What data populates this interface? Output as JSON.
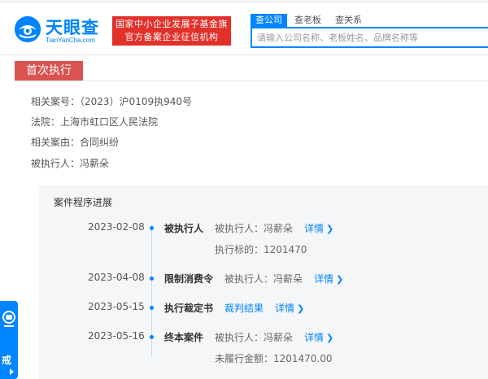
{
  "header": {
    "logo_name": "天眼查",
    "logo_domain": "TianYanCha.com",
    "slogan_line1": "国家中小企业发展子基金旗下",
    "slogan_line2": "官方备案企业征信机构",
    "tabs": [
      {
        "label": "查公司"
      },
      {
        "label": "查老板"
      },
      {
        "label": "查关系"
      }
    ],
    "search_placeholder": "请输入公司名称、老板姓名、品牌名称等"
  },
  "section": {
    "title": "首次执行",
    "fields": [
      {
        "label": "相关案号：",
        "value": "（2023）沪0109执940号"
      },
      {
        "label": "法院：",
        "value": "上海市虹口区人民法院"
      },
      {
        "label": "相关案由：",
        "value": "合同纠纷"
      },
      {
        "label": "被执行人：",
        "value": "冯薪朵"
      }
    ]
  },
  "progress": {
    "title": "案件程序进展",
    "events": [
      {
        "date": "2023-02-08",
        "kind": "被执行人",
        "party": "被执行人：冯薪朵",
        "detail": "详情",
        "sub": "执行标的：1201470"
      },
      {
        "date": "2023-04-08",
        "kind": "限制消费令",
        "party": "被执行人：冯薪朵",
        "detail": "详情"
      },
      {
        "date": "2023-05-15",
        "kind": "执行裁定书",
        "link": "裁判结果",
        "detail": "详情"
      },
      {
        "date": "2023-05-16",
        "kind": "终本案件",
        "party": "被执行人：冯薪朵",
        "detail": "详情",
        "sub": "未履行金额：1201470.00"
      }
    ]
  },
  "float_widget": {
    "label": "戒",
    "icon": "customer-service-icon"
  },
  "colors": {
    "brand": "#0084ff",
    "slogan_bg": "#e2312a",
    "section_tab": "#d9534f",
    "panel_bg": "#f5f6f8"
  }
}
